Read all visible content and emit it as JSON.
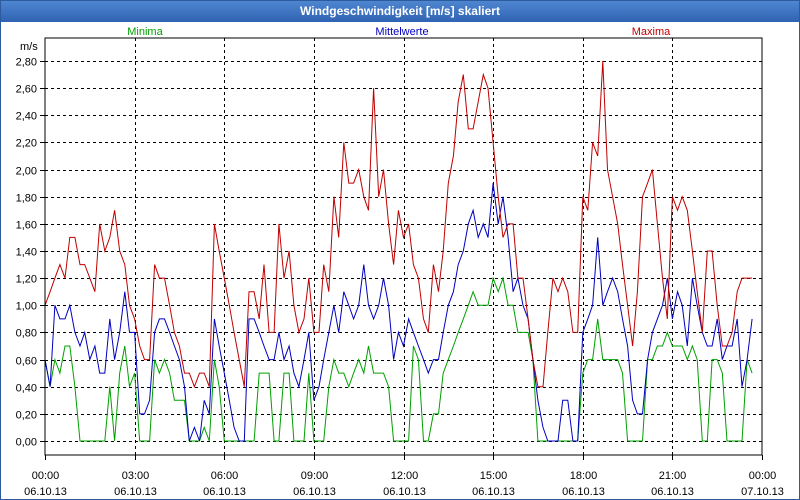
{
  "window": {
    "title": "Windgeschwindigkeit [m/s] skaliert"
  },
  "chart_data": {
    "type": "line",
    "title": "Windgeschwindigkeit [m/s] skaliert",
    "ylabel": "m/s",
    "ylim": [
      0,
      2.8
    ],
    "y_ticks": [
      "0,00",
      "0,20",
      "0,40",
      "0,60",
      "0,80",
      "1,00",
      "1,20",
      "1,40",
      "1,60",
      "1,80",
      "2,00",
      "2,20",
      "2,40",
      "2,60",
      "2,80"
    ],
    "x_ticks": [
      {
        "time": "00:00",
        "date": "06.10.13"
      },
      {
        "time": "03:00",
        "date": "06.10.13"
      },
      {
        "time": "06:00",
        "date": "06.10.13"
      },
      {
        "time": "09:00",
        "date": "06.10.13"
      },
      {
        "time": "12:00",
        "date": "06.10.13"
      },
      {
        "time": "15:00",
        "date": "06.10.13"
      },
      {
        "time": "18:00",
        "date": "06.10.13"
      },
      {
        "time": "21:00",
        "date": "06.10.13"
      },
      {
        "time": "00:00",
        "date": "07.10.13"
      }
    ],
    "x_hours": [
      0,
      0.17,
      0.33,
      0.5,
      0.67,
      0.83,
      1,
      1.17,
      1.33,
      1.5,
      1.67,
      1.83,
      2,
      2.17,
      2.33,
      2.5,
      2.67,
      2.83,
      3,
      3.17,
      3.33,
      3.5,
      3.67,
      3.83,
      4,
      4.17,
      4.33,
      4.5,
      4.67,
      4.83,
      5,
      5.17,
      5.33,
      5.5,
      5.67,
      5.83,
      6,
      6.17,
      6.33,
      6.5,
      6.67,
      6.83,
      7,
      7.17,
      7.33,
      7.5,
      7.67,
      7.83,
      8,
      8.17,
      8.33,
      8.5,
      8.67,
      8.83,
      9,
      9.17,
      9.33,
      9.5,
      9.67,
      9.83,
      10,
      10.17,
      10.33,
      10.5,
      10.67,
      10.83,
      11,
      11.17,
      11.33,
      11.5,
      11.67,
      11.83,
      12,
      12.17,
      12.33,
      12.5,
      12.67,
      12.83,
      13,
      13.17,
      13.33,
      13.5,
      13.67,
      13.83,
      14,
      14.17,
      14.33,
      14.5,
      14.67,
      14.83,
      15,
      15.17,
      15.33,
      15.5,
      15.67,
      15.83,
      16,
      16.17,
      16.33,
      16.5,
      16.67,
      16.83,
      17,
      17.17,
      17.33,
      17.5,
      17.67,
      17.83,
      18,
      18.17,
      18.33,
      18.5,
      18.67,
      18.83,
      19,
      19.17,
      19.33,
      19.5,
      19.67,
      19.83,
      20,
      20.17,
      20.33,
      20.5,
      20.67,
      20.83,
      21,
      21.17,
      21.33,
      21.5,
      21.67,
      21.83,
      22,
      22.17,
      22.33,
      22.5,
      22.67,
      22.83,
      23,
      23.17,
      23.33,
      23.5,
      23.67
    ],
    "series": [
      {
        "name": "Minima",
        "color": "#00a000",
        "values": [
          0.6,
          0.4,
          0.6,
          0.5,
          0.7,
          0.7,
          0.4,
          0.0,
          0.0,
          0.0,
          0.0,
          0.0,
          0.0,
          0.4,
          0.0,
          0.5,
          0.7,
          0.4,
          0.5,
          0.0,
          0.0,
          0.0,
          0.6,
          0.5,
          0.6,
          0.5,
          0.3,
          0.3,
          0.3,
          0.0,
          0.0,
          0.0,
          0.1,
          0.0,
          0.6,
          0.4,
          0.0,
          0.0,
          0.0,
          0.0,
          0.0,
          0.0,
          0.0,
          0.5,
          0.5,
          0.5,
          0.0,
          0.0,
          0.5,
          0.5,
          0.0,
          0.0,
          0.0,
          0.5,
          0.0,
          0.0,
          0.0,
          0.4,
          0.6,
          0.5,
          0.5,
          0.4,
          0.5,
          0.6,
          0.5,
          0.7,
          0.5,
          0.5,
          0.5,
          0.4,
          0.0,
          0.0,
          0.0,
          0.0,
          0.7,
          0.6,
          0.0,
          0.0,
          0.2,
          0.2,
          0.5,
          0.6,
          0.7,
          0.8,
          0.9,
          1.0,
          1.1,
          1.0,
          1.0,
          1.0,
          1.2,
          1.1,
          1.2,
          1.0,
          1.0,
          0.8,
          0.8,
          0.8,
          0.6,
          0.0,
          0.0,
          0.0,
          0.0,
          0.0,
          0.0,
          0.0,
          0.0,
          0.0,
          0.5,
          0.6,
          0.6,
          0.9,
          0.6,
          0.6,
          0.6,
          0.6,
          0.5,
          0.0,
          0.0,
          0.0,
          0.0,
          0.6,
          0.6,
          0.7,
          0.7,
          0.8,
          0.7,
          0.7,
          0.7,
          0.6,
          0.7,
          0.6,
          0.0,
          0.0,
          0.6,
          0.6,
          0.5,
          0.0,
          0.0,
          0.0,
          0.0,
          0.6,
          0.5
        ]
      },
      {
        "name": "Mittelwerte",
        "color": "#0000c0",
        "values": [
          0.6,
          0.4,
          1.0,
          0.9,
          0.9,
          1.0,
          0.8,
          0.7,
          0.8,
          0.6,
          0.7,
          0.5,
          0.5,
          0.9,
          0.6,
          0.8,
          1.1,
          0.8,
          0.8,
          0.2,
          0.2,
          0.3,
          0.8,
          0.9,
          0.9,
          0.8,
          0.7,
          0.6,
          0.4,
          0.0,
          0.1,
          0.0,
          0.3,
          0.2,
          0.9,
          0.7,
          0.5,
          0.3,
          0.1,
          0.0,
          0.0,
          0.9,
          0.9,
          0.8,
          0.7,
          0.6,
          0.6,
          0.8,
          0.6,
          0.7,
          0.5,
          0.4,
          0.6,
          0.8,
          0.3,
          0.4,
          0.6,
          0.8,
          1.0,
          0.8,
          1.1,
          1.0,
          0.9,
          1.0,
          1.3,
          1.0,
          0.9,
          1.0,
          1.2,
          1.0,
          0.6,
          0.8,
          0.7,
          0.9,
          0.8,
          0.7,
          0.6,
          0.5,
          0.6,
          0.6,
          0.8,
          1.0,
          1.1,
          1.3,
          1.4,
          1.6,
          1.7,
          1.5,
          1.6,
          1.5,
          1.9,
          1.6,
          1.8,
          1.5,
          1.1,
          1.2,
          1.0,
          0.9,
          0.6,
          0.3,
          0.1,
          0.0,
          0.0,
          0.0,
          0.3,
          0.3,
          0.0,
          0.0,
          0.8,
          0.9,
          1.0,
          1.5,
          1.0,
          1.1,
          1.2,
          1.1,
          0.9,
          0.7,
          0.3,
          0.2,
          0.2,
          0.6,
          0.8,
          0.9,
          1.0,
          1.2,
          0.9,
          1.1,
          1.0,
          0.7,
          1.2,
          1.0,
          0.8,
          0.7,
          0.7,
          0.9,
          0.6,
          0.7,
          0.7,
          0.9,
          0.4,
          0.6,
          0.9,
          0.9
        ]
      },
      {
        "name": "Maxima",
        "color": "#c00000",
        "values": [
          1.0,
          1.1,
          1.2,
          1.3,
          1.2,
          1.5,
          1.5,
          1.3,
          1.3,
          1.2,
          1.1,
          1.6,
          1.4,
          1.5,
          1.7,
          1.4,
          1.3,
          1.0,
          0.9,
          0.7,
          0.6,
          0.6,
          1.3,
          1.2,
          1.2,
          1.0,
          0.8,
          0.7,
          0.5,
          0.5,
          0.4,
          0.5,
          0.5,
          0.4,
          1.6,
          1.4,
          1.2,
          1.0,
          0.8,
          0.6,
          0.4,
          1.1,
          1.1,
          0.9,
          1.3,
          0.8,
          0.8,
          1.6,
          1.2,
          1.4,
          1.0,
          0.8,
          0.9,
          1.2,
          0.8,
          0.8,
          1.3,
          1.1,
          1.8,
          1.5,
          2.2,
          1.9,
          1.9,
          2.0,
          1.8,
          1.7,
          2.6,
          1.8,
          2.0,
          1.6,
          1.3,
          1.7,
          1.5,
          1.6,
          1.3,
          1.2,
          0.9,
          0.8,
          1.3,
          1.1,
          1.4,
          1.9,
          2.1,
          2.5,
          2.7,
          2.3,
          2.3,
          2.5,
          2.7,
          2.6,
          2.2,
          1.8,
          1.5,
          1.6,
          1.6,
          1.2,
          1.2,
          0.9,
          0.6,
          0.4,
          0.4,
          0.8,
          1.2,
          1.1,
          1.2,
          1.1,
          0.8,
          0.8,
          1.8,
          1.7,
          2.2,
          2.1,
          2.8,
          2.0,
          1.8,
          1.6,
          1.3,
          1.0,
          0.7,
          1.1,
          1.8,
          1.9,
          2.0,
          1.6,
          1.2,
          0.9,
          1.8,
          1.7,
          1.8,
          1.7,
          1.4,
          1.1,
          0.8,
          1.4,
          1.4,
          1.0,
          0.7,
          0.7,
          0.8,
          1.1,
          1.2,
          1.2,
          1.2
        ]
      }
    ],
    "grid": "dashed",
    "legend_placement": "top"
  }
}
